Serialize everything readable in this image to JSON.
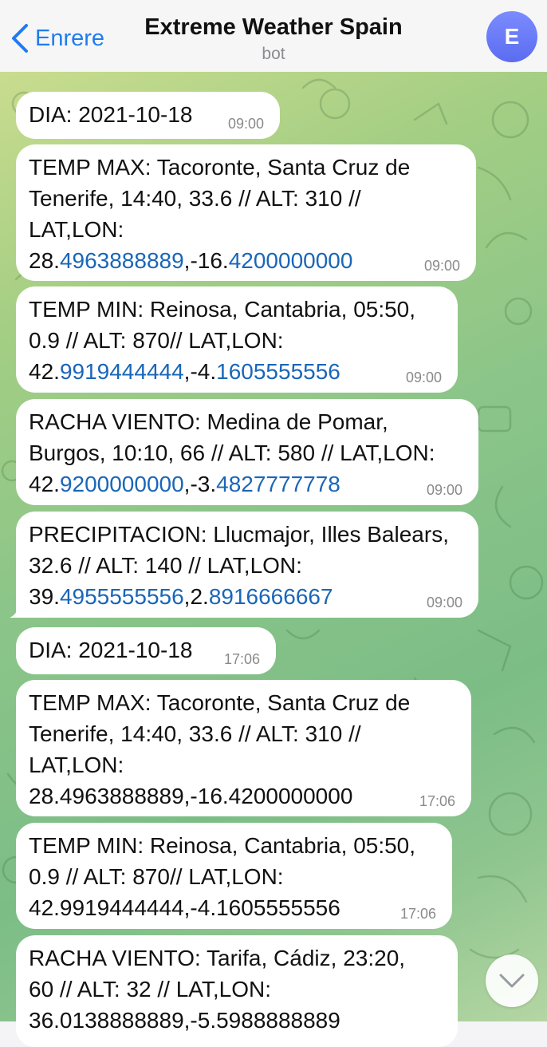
{
  "header": {
    "back_label": "Enrere",
    "title": "Extreme Weather Spain",
    "subtitle": "bot",
    "avatar_letter": "E"
  },
  "messages": [
    {
      "lines": [
        "DIA: 2021-10-18"
      ],
      "time": "09:00"
    },
    {
      "lines": [
        "TEMP MAX: Tacoronte, Santa Cruz de",
        "Tenerife, 14:40, 33.6 // ALT: 310 //",
        "LAT,LON:"
      ],
      "coords": {
        "lat_int": "28.",
        "lat_dec": "4963888889",
        "lon_int": ",-16.",
        "lon_dec": "4200000000"
      },
      "time": "09:00"
    },
    {
      "lines": [
        "TEMP MIN: Reinosa, Cantabria, 05:50,",
        "0.9 // ALT: 870// LAT,LON:"
      ],
      "coords": {
        "lat_int": "42.",
        "lat_dec": "9919444444",
        "lon_int": ",-4.",
        "lon_dec": "1605555556"
      },
      "time": "09:00"
    },
    {
      "lines": [
        "RACHA VIENTO: Medina de Pomar,",
        "Burgos, 10:10, 66 // ALT: 580 // LAT,LON:"
      ],
      "coords": {
        "lat_int": "42.",
        "lat_dec": "9200000000",
        "lon_int": ",-3.",
        "lon_dec": "4827777778"
      },
      "time": "09:00"
    },
    {
      "lines": [
        "PRECIPITACION: Llucmajor, Illes Balears,",
        "32.6 // ALT: 140 // LAT,LON:"
      ],
      "coords": {
        "lat_int": "39.",
        "lat_dec": "4955555556",
        "lon_int": ",2.",
        "lon_dec": "8916666667"
      },
      "time": "09:00"
    },
    {
      "lines": [
        "DIA: 2021-10-18"
      ],
      "time": "17:06"
    },
    {
      "lines": [
        "TEMP MAX: Tacoronte, Santa Cruz de",
        "Tenerife, 14:40, 33.6 // ALT: 310 //",
        "LAT,LON:",
        "28.4963888889,-16.4200000000"
      ],
      "time": "17:06"
    },
    {
      "lines": [
        "TEMP MIN: Reinosa, Cantabria, 05:50,",
        "0.9 // ALT: 870// LAT,LON:",
        "42.9919444444,-4.1605555556"
      ],
      "time": "17:06"
    },
    {
      "lines": [
        "RACHA VIENTO: Tarifa, Cádiz, 23:20,",
        "60 // ALT: 32 // LAT,LON:",
        "36.0138888889,-5.5988888889"
      ]
    }
  ],
  "icons": {
    "back": "chevron-left-icon",
    "scroll": "chevron-down-icon"
  },
  "colors": {
    "accent": "#1f7cf0",
    "link": "#1a66b8",
    "avatar": "#6677f5"
  }
}
